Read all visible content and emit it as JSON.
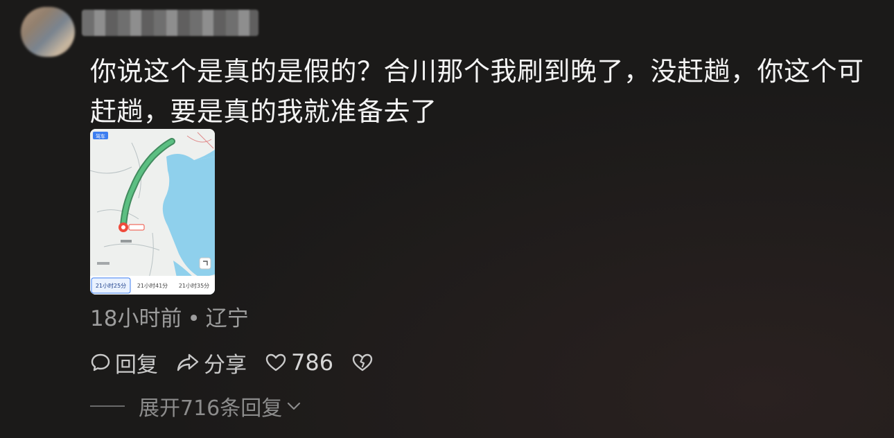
{
  "comment": {
    "username": "",
    "text": "你说这个是真的是假的？合川那个我刷到晚了，没赶趟，你这个可赶趟，要是真的我就准备去了",
    "time": "18小时前",
    "location": "辽宁",
    "separator": "•",
    "image": {
      "icon": "map-route-screenshot",
      "top_badge": "驾车",
      "route_options": [
        "21小时25分",
        "21小时41分",
        "21小时35分"
      ]
    }
  },
  "actions": {
    "reply_label": "回复",
    "reply_icon": "comment-bubble-icon",
    "share_label": "分享",
    "share_icon": "share-arrow-icon",
    "like_icon": "heart-outline-icon",
    "like_count": "786",
    "dislike_icon": "broken-heart-icon"
  },
  "replies": {
    "expand_label": "展开716条回复",
    "expand_icon": "chevron-down-icon"
  },
  "colors": {
    "background": "#1b1a19",
    "text_primary": "#f4f4f4",
    "text_secondary": "#9d9d9d",
    "route_green": "#3fa56b",
    "water_blue": "#8fd0ec"
  }
}
